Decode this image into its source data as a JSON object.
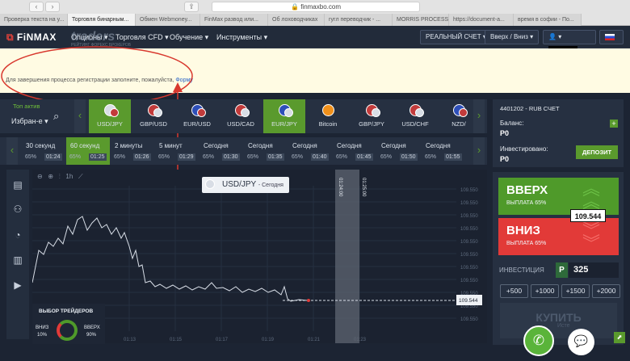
{
  "browser": {
    "url": "finmaxbo.com",
    "tabs": [
      "Проверка текста на у...",
      "Торговля бинарным...",
      "Обмен Webmoney...",
      "FinMax развод или...",
      "Об лоховодчиках",
      "гугл переводчик - ...",
      "MORRIS PROCESSI...",
      "https://document-a...",
      "время в софии - По..."
    ],
    "active_tab": 1
  },
  "header": {
    "logo": "FiNMAX",
    "menu": [
      "Опционы",
      "Торговля CFD",
      "Обучение",
      "Инструменты"
    ],
    "account_button": "РЕАЛЬНЫЙ СЧЕТ",
    "mode_button": "Вверх / Вниз",
    "watermark": "traders",
    "watermark_sub": "РЕЙТИНГ ФОРЕКС БРОКЕРОВ"
  },
  "banner": {
    "text": "Для завершения процесса регистрации заполните, пожалуйста, ",
    "link": "Форму"
  },
  "assets": {
    "top_label": "Топ актив",
    "filter": "Избран-е",
    "items": [
      "USD/JPY",
      "GBP/USD",
      "EUR/USD",
      "USD/CAD",
      "EUR/JPY",
      "Bitcoin",
      "GBP/JPY",
      "USD/CHF",
      "NZD/"
    ],
    "selected": 0,
    "highlighted": 4
  },
  "expiry": {
    "items": [
      {
        "label": "30 секунд",
        "pct": "65%",
        "time": "01:24"
      },
      {
        "label": "60 секунд",
        "pct": "65%",
        "time": "01:25"
      },
      {
        "label": "2 минуты",
        "pct": "65%",
        "time": "01:26"
      },
      {
        "label": "5 минут",
        "pct": "65%",
        "time": "01:29"
      },
      {
        "label": "Сегодня",
        "pct": "65%",
        "time": "01:30"
      },
      {
        "label": "Сегодня",
        "pct": "65%",
        "time": "01:35"
      },
      {
        "label": "Сегодня",
        "pct": "65%",
        "time": "01:40"
      },
      {
        "label": "Сегодня",
        "pct": "65%",
        "time": "01:45"
      },
      {
        "label": "Сегодня",
        "pct": "65%",
        "time": "01:50"
      },
      {
        "label": "Сегодня",
        "pct": "65%",
        "time": "01:55"
      }
    ],
    "selected": 1
  },
  "chart": {
    "pair": "USD/JPY",
    "period": "- Сегодня",
    "timeframe": "1h",
    "current_price": "109.544",
    "x_labels": [
      "01:13",
      "01:15",
      "01:17",
      "01:19",
      "01:21",
      "01:23"
    ],
    "y_labels": [
      "109.550",
      "109.550",
      "109.550",
      "109.550",
      "109.550",
      "109.550",
      "109.550",
      "109.550",
      "109.550",
      "109.550",
      "109.550"
    ],
    "expiry_markers": [
      "01:24:00",
      "01:25:00"
    ]
  },
  "traders": {
    "title": "ВЫБОР ТРЕЙДЕРОВ",
    "down_label": "ВНИЗ",
    "down_pct": "10%",
    "up_label": "ВВЕРХ",
    "up_pct": "90%"
  },
  "account": {
    "id": "4401202 - RUB СЧЕТ",
    "balance_label": "Баланс:",
    "balance": "Р0",
    "invested_label": "Инвестировано:",
    "invested": "Р0",
    "deposit_button": "ДЕПОЗИТ"
  },
  "trade": {
    "up_label": "ВВЕРХ",
    "up_payout": "ВЫПЛАТА 65%",
    "down_label": "ВНИЗ",
    "down_payout": "ВЫПЛАТА 65%",
    "price": "109.544",
    "invest_label": "ИНВЕСТИЦИЯ",
    "currency": "Р",
    "amount": "325",
    "quick_amounts": [
      "+500",
      "+1000",
      "+1500",
      "+2000"
    ],
    "buy_button": "КУПИТЬ",
    "buy_sub": "Исте"
  }
}
